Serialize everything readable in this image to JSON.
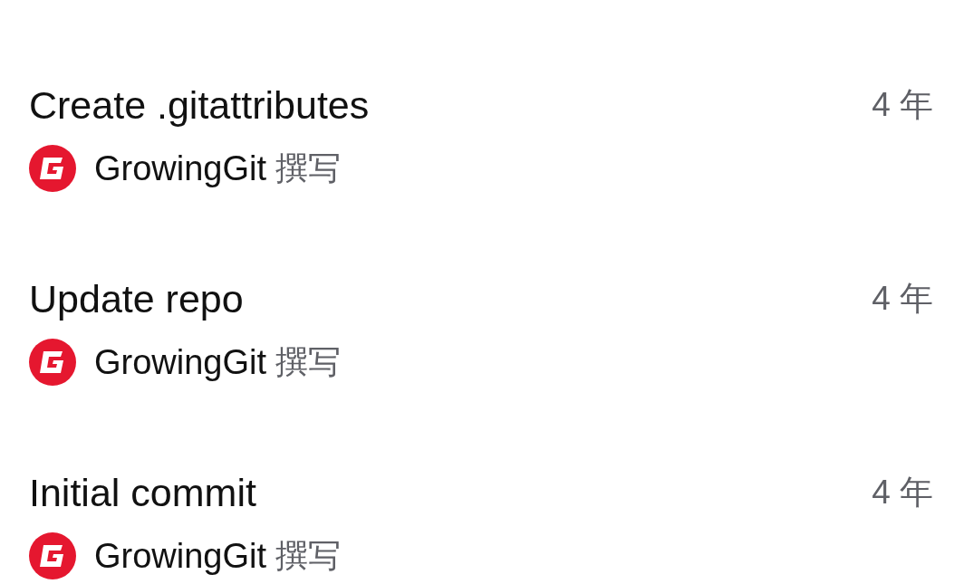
{
  "commits": [
    {
      "title": "Create .gitattributes",
      "time": "4 年",
      "author": "GrowingGit",
      "verb": "撰写"
    },
    {
      "title": "Update repo",
      "time": "4 年",
      "author": "GrowingGit",
      "verb": "撰写"
    },
    {
      "title": "Initial commit",
      "time": "4 年",
      "author": "GrowingGit",
      "verb": "撰写"
    }
  ]
}
